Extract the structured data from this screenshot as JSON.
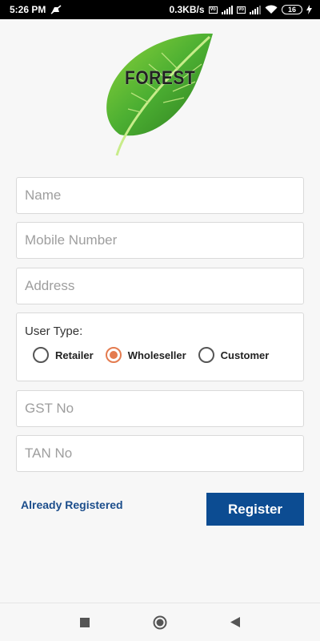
{
  "status_bar": {
    "time": "5:26 PM",
    "network_speed": "0.3KB/s",
    "battery_level": "16",
    "icons": [
      "mute-icon",
      "volte-icon",
      "signal-4g-icon",
      "signal-icon",
      "wifi-icon",
      "battery-icon",
      "charging-icon"
    ]
  },
  "logo": {
    "text": "FOREST",
    "leaf_color": "#4caf32"
  },
  "form": {
    "name_placeholder": "Name",
    "mobile_placeholder": "Mobile Number",
    "address_placeholder": "Address",
    "user_type": {
      "label": "User Type:",
      "options": [
        "Retailer",
        "Wholeseller",
        "Customer"
      ],
      "selected": "Wholeseller"
    },
    "gst_placeholder": "GST No",
    "tan_placeholder": "TAN No"
  },
  "actions": {
    "already_registered": "Already Registered",
    "register": "Register"
  },
  "colors": {
    "primary": "#0c4c92",
    "link": "#1b4d8b",
    "radio_accent": "#e47b4f"
  },
  "nav_bar": {
    "buttons": [
      "recents-square-icon",
      "home-circle-icon",
      "back-triangle-icon"
    ]
  }
}
